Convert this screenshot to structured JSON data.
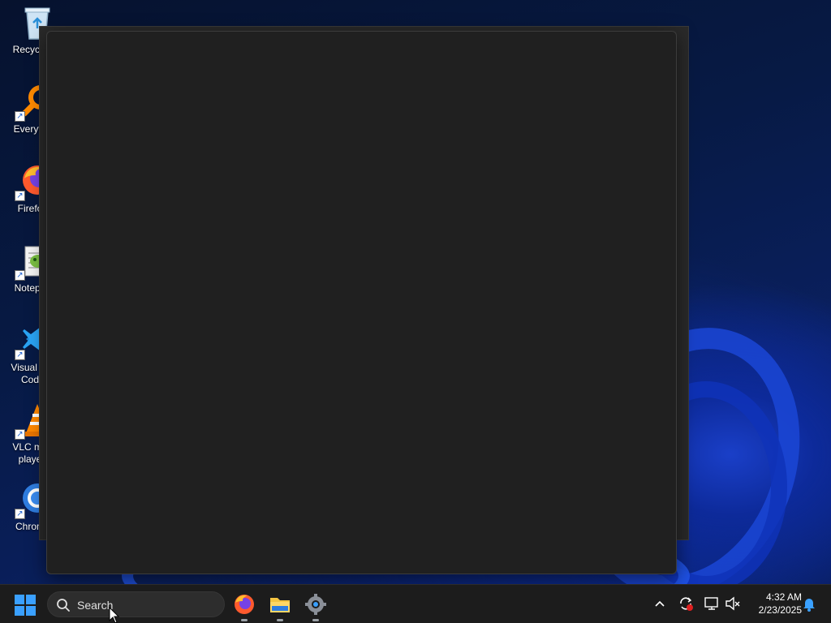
{
  "desktop": {
    "icons": [
      {
        "label": "Recycle",
        "icon": "recycle-bin-icon"
      },
      {
        "label": "Everyth",
        "icon": "everything-search-icon"
      },
      {
        "label": "Firefo",
        "icon": "firefox-icon"
      },
      {
        "label": "Notepa",
        "icon": "notepad-plus-plus-icon"
      },
      {
        "label": "Visual St\nCod",
        "icon": "vscode-icon"
      },
      {
        "label": "VLC me\nplaye",
        "icon": "vlc-icon"
      },
      {
        "label": "Chrom",
        "icon": "chrome-icon"
      }
    ]
  },
  "taskbar": {
    "search_placeholder": "Search",
    "apps": [
      "firefox-icon",
      "file-explorer-icon",
      "settings-icon"
    ],
    "tray_icons": [
      "chevron-up-icon",
      "sync-icon",
      "network-icon",
      "volume-muted-icon",
      "notification-bell-icon"
    ],
    "time": "4:32 AM",
    "date": "2/23/2025"
  },
  "colors": {
    "window_bg": "#202020",
    "taskbar_bg": "#1c1c1c",
    "accent": "#3aa0ff"
  }
}
